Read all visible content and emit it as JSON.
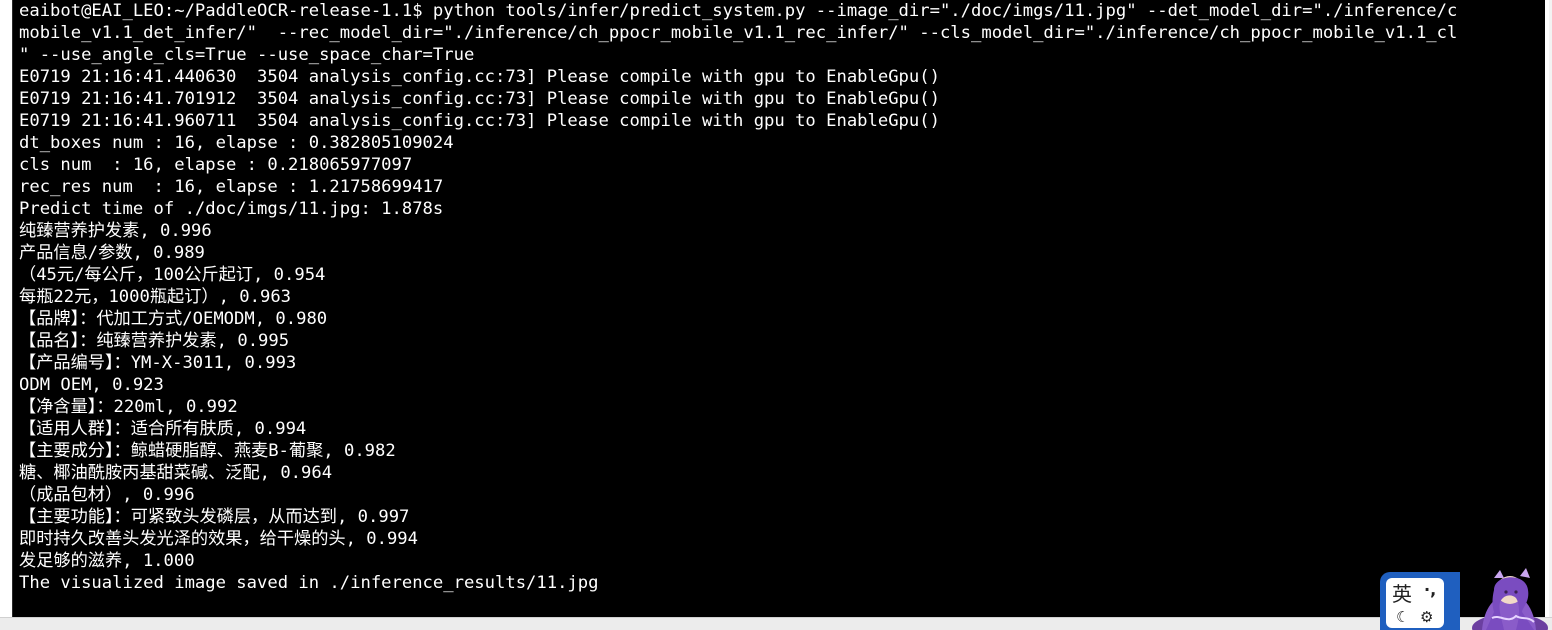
{
  "terminal": {
    "lines": [
      "eaibot@EAI_LEO:~/PaddleOCR-release-1.1$ python tools/infer/predict_system.py --image_dir=\"./doc/imgs/11.jpg\" --det_model_dir=\"./inference/c",
      "mobile_v1.1_det_infer/\"  --rec_model_dir=\"./inference/ch_ppocr_mobile_v1.1_rec_infer/\" --cls_model_dir=\"./inference/ch_ppocr_mobile_v1.1_cl",
      "\" --use_angle_cls=True --use_space_char=True",
      "E0719 21:16:41.440630  3504 analysis_config.cc:73] Please compile with gpu to EnableGpu()",
      "E0719 21:16:41.701912  3504 analysis_config.cc:73] Please compile with gpu to EnableGpu()",
      "E0719 21:16:41.960711  3504 analysis_config.cc:73] Please compile with gpu to EnableGpu()",
      "dt_boxes num : 16, elapse : 0.382805109024",
      "cls num  : 16, elapse : 0.218065977097",
      "rec_res num  : 16, elapse : 1.21758699417",
      "Predict time of ./doc/imgs/11.jpg: 1.878s",
      "纯臻营养护发素, 0.996",
      "产品信息/参数, 0.989",
      "（45元/每公斤，100公斤起订, 0.954",
      "每瓶22元，1000瓶起订）, 0.963",
      "【品牌】：代加工方式/OEMODM, 0.980",
      "【品名】：纯臻营养护发素, 0.995",
      "【产品编号】：YM-X-3011, 0.993",
      "ODM OEM, 0.923",
      "【净含量】：220ml, 0.992",
      "【适用人群】：适合所有肤质, 0.994",
      "【主要成分】：鲸蜡硬脂醇、燕麦B-葡聚, 0.982",
      "糖、椰油酰胺丙基甜菜碱、泛配, 0.964",
      "（成品包材）, 0.996",
      "【主要功能】：可紧致头发磷层，从而达到, 0.997",
      "即时持久改善头发光泽的效果，给干燥的头, 0.994",
      "发足够的滋养, 1.000",
      "The visualized image saved in ./inference_results/11.jpg"
    ]
  },
  "ime": {
    "language": "英",
    "punctuation": "·,",
    "moon_icon": "moon-icon",
    "settings_icon": "gear-icon"
  },
  "colors": {
    "terminal_bg": "#000000",
    "terminal_fg": "#ffffff",
    "ime_blue": "#1f5fbf"
  }
}
